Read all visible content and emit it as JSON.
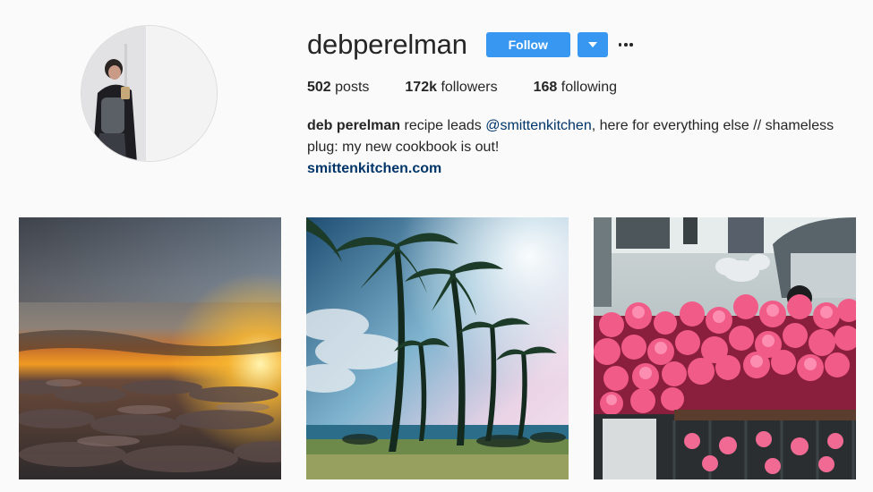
{
  "profile": {
    "username": "debperelman",
    "follow_label": "Follow",
    "stats": {
      "posts_count": "502",
      "posts_label": "posts",
      "followers_count": "172k",
      "followers_label": "followers",
      "following_count": "168",
      "following_label": "following"
    },
    "bio": {
      "name": "deb perelman",
      "text_before": "recipe leads",
      "mention": "@smittenkitchen",
      "text_after": ", here for everything else // shameless plug: my new cookbook is out!",
      "website": "smittenkitchen.com"
    }
  },
  "posts": [
    {
      "subject": "sunset-over-clouds"
    },
    {
      "subject": "palm-trees-beach"
    },
    {
      "subject": "pink-flowers-street"
    }
  ],
  "colors": {
    "accent": "#3897f0",
    "link": "#003569",
    "text": "#262626",
    "background": "#fafafa"
  },
  "icons": [
    "caret-down-icon",
    "more-options-icon"
  ]
}
